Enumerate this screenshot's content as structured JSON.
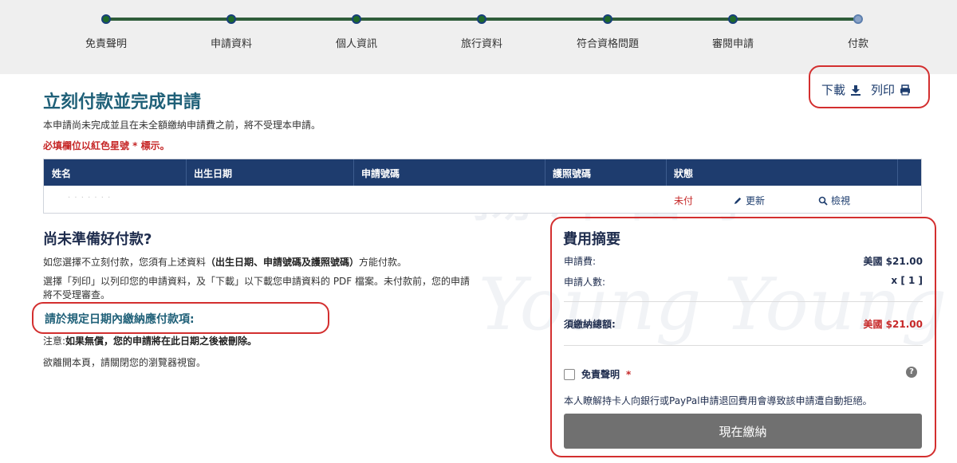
{
  "progress": {
    "steps": [
      "免責聲明",
      "申請資料",
      "個人資訊",
      "旅行資料",
      "符合資格問題",
      "審閱申請",
      "付款"
    ]
  },
  "watermark": {
    "cn": "揚洋留學",
    "en": "Young Young S"
  },
  "tools": {
    "download": "下載",
    "print": "列印"
  },
  "main": {
    "title": "立刻付款並完成申請",
    "intro": "本申請尚未完成並且在未全額繳納申請費之前，將不受理本申請。",
    "required_note": "必填欄位以紅色星號 * 標示。"
  },
  "table": {
    "headers": [
      "姓名",
      "出生日期",
      "申請號碼",
      "護照號碼",
      "狀態"
    ],
    "row": {
      "name": "· · · · · · ·",
      "status": "未付",
      "update": "更新",
      "view": "檢視"
    }
  },
  "left": {
    "heading": "尚未準備好付款?",
    "p1_prefix": "如您選擇不立刻付款，您須有上述資料",
    "p1_bold": "（出生日期、申請號碼及護照號碼）",
    "p1_suffix": "方能付款。",
    "p2": "選擇「列印」以列印您的申請資料，及「下載」以下載您申請資料的 PDF 檔案。未付款前，您的申請將不受理審查。",
    "deadline": "請於規定日期內繳納應付款項:",
    "note_prefix": "注意:",
    "note_bold": "如果無償，您的申請將在此日期之後被刪除。",
    "leave": "欲離開本頁，請關閉您的瀏覽器視窗。"
  },
  "fee": {
    "title": "費用摘要",
    "fee_label": "申請費:",
    "fee_value": "美國 $21.00",
    "count_label": "申請人數:",
    "count_value": "x [ 1 ]",
    "total_label": "須繳納總額:",
    "total_value": "美國 $21.00",
    "agree_label": "免責聲明",
    "agree_star": "*",
    "help": "?",
    "disclaimer": "本人瞭解持卡人向銀行或PayPal申請退回費用會導致該申請遭自動拒絕。",
    "pay_button": "現在繳納"
  },
  "colors": {
    "header_bar": "#1e3c6e",
    "title": "#1f6078",
    "red": "#c62828",
    "button": "#707070"
  }
}
